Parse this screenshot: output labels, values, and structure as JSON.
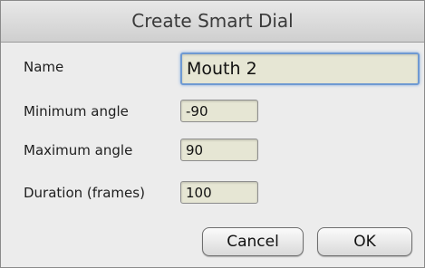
{
  "dialog": {
    "title": "Create Smart Dial",
    "fields": {
      "name": {
        "label": "Name",
        "value": "Mouth 2"
      },
      "min_angle": {
        "label": "Minimum angle",
        "value": "-90"
      },
      "max_angle": {
        "label": "Maximum angle",
        "value": "90"
      },
      "duration": {
        "label": "Duration (frames)",
        "value": "100"
      }
    },
    "buttons": {
      "cancel": "Cancel",
      "ok": "OK"
    }
  }
}
